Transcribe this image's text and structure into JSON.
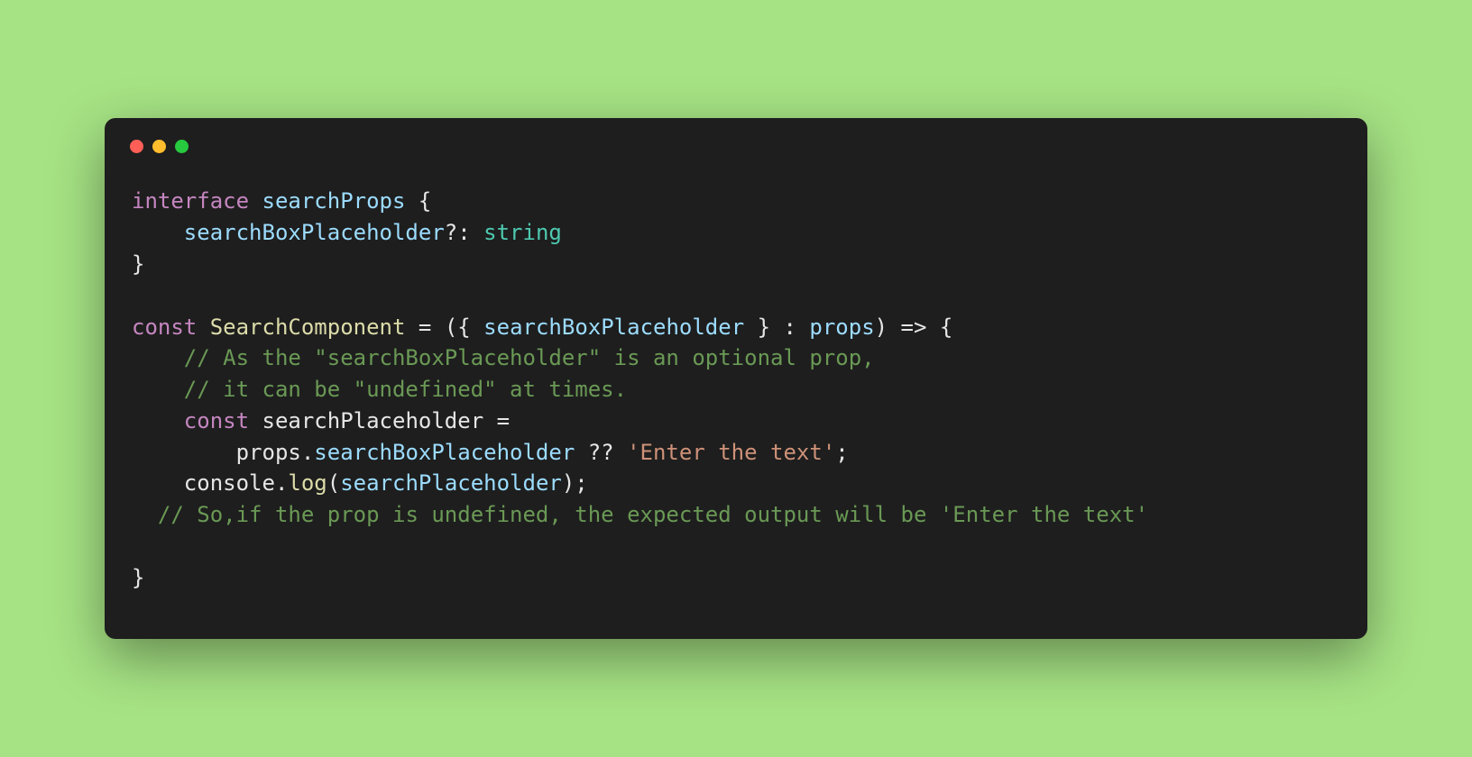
{
  "code": {
    "line1": {
      "kw": "interface",
      "name": "searchProps",
      "brace": " {"
    },
    "line2": {
      "indent": "    ",
      "prop": "searchBoxPlaceholder",
      "opt": "?:",
      "sp": " ",
      "type": "string"
    },
    "line3": {
      "brace": "}"
    },
    "line5": {
      "kw": "const",
      "sp1": " ",
      "name": "SearchComponent",
      "eq": " = ",
      "lp": "({ ",
      "param": "searchBoxPlaceholder",
      "rp": " } : ",
      "type": "props",
      "arrow": ") => {"
    },
    "line6": {
      "indent": "    ",
      "comment": "// As the \"searchBoxPlaceholder\" is an optional prop,"
    },
    "line7": {
      "indent": "    ",
      "comment": "// it can be \"undefined\" at times."
    },
    "line8": {
      "indent": "    ",
      "kw": "const",
      "sp": " ",
      "name": "searchPlaceholder",
      "eq": " ="
    },
    "line9": {
      "indent": "        ",
      "obj": "props",
      "dot": ".",
      "prop": "searchBoxPlaceholder",
      "nullish": " ?? ",
      "str": "'Enter the text'",
      "semi": ";"
    },
    "line10": {
      "indent": "    ",
      "obj": "console",
      "dot": ".",
      "fn": "log",
      "lp": "(",
      "arg": "searchPlaceholder",
      "rp": ");"
    },
    "line11": {
      "indent": "  ",
      "comment": "// So,if the prop is undefined, the expected output will be 'Enter the text'"
    },
    "line13": {
      "brace": "}"
    }
  }
}
